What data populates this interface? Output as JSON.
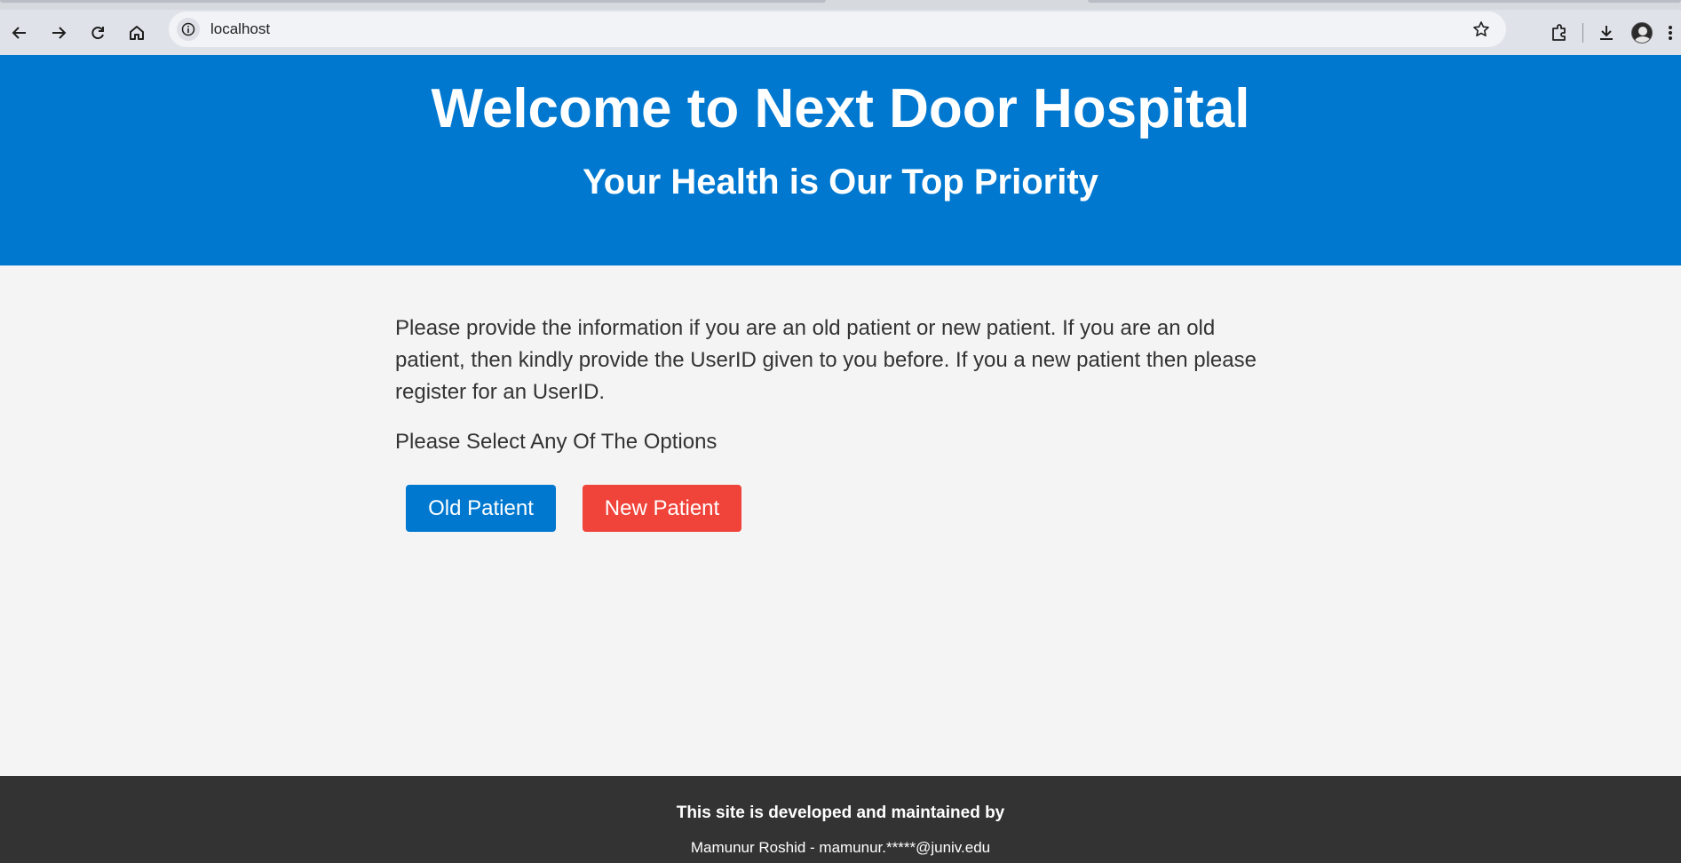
{
  "browser": {
    "url": "localhost"
  },
  "hero": {
    "title": "Welcome to Next Door Hospital",
    "subtitle": "Your Health is Our Top Priority",
    "background_color": "#0078d0"
  },
  "content": {
    "intro": "Please provide the information if you are an old patient or new patient. If you are an old patient, then kindly provide the UserID given to you before. If you a new patient then please register for an UserID.",
    "prompt": "Please Select Any Of The Options",
    "old_patient_label": "Old Patient",
    "new_patient_label": "New Patient",
    "old_patient_color": "#0078d0",
    "new_patient_color": "#f0433a"
  },
  "footer": {
    "line1": "This site is developed and maintained by",
    "line2": "Mamunur Roshid - mamunur.*****@juniv.edu",
    "background_color": "#333333"
  },
  "icons": [
    "back-icon",
    "forward-icon",
    "reload-icon",
    "home-icon",
    "site-info-icon",
    "bookmark-star-icon",
    "extensions-icon",
    "download-icon",
    "profile-avatar",
    "menu-icon"
  ]
}
